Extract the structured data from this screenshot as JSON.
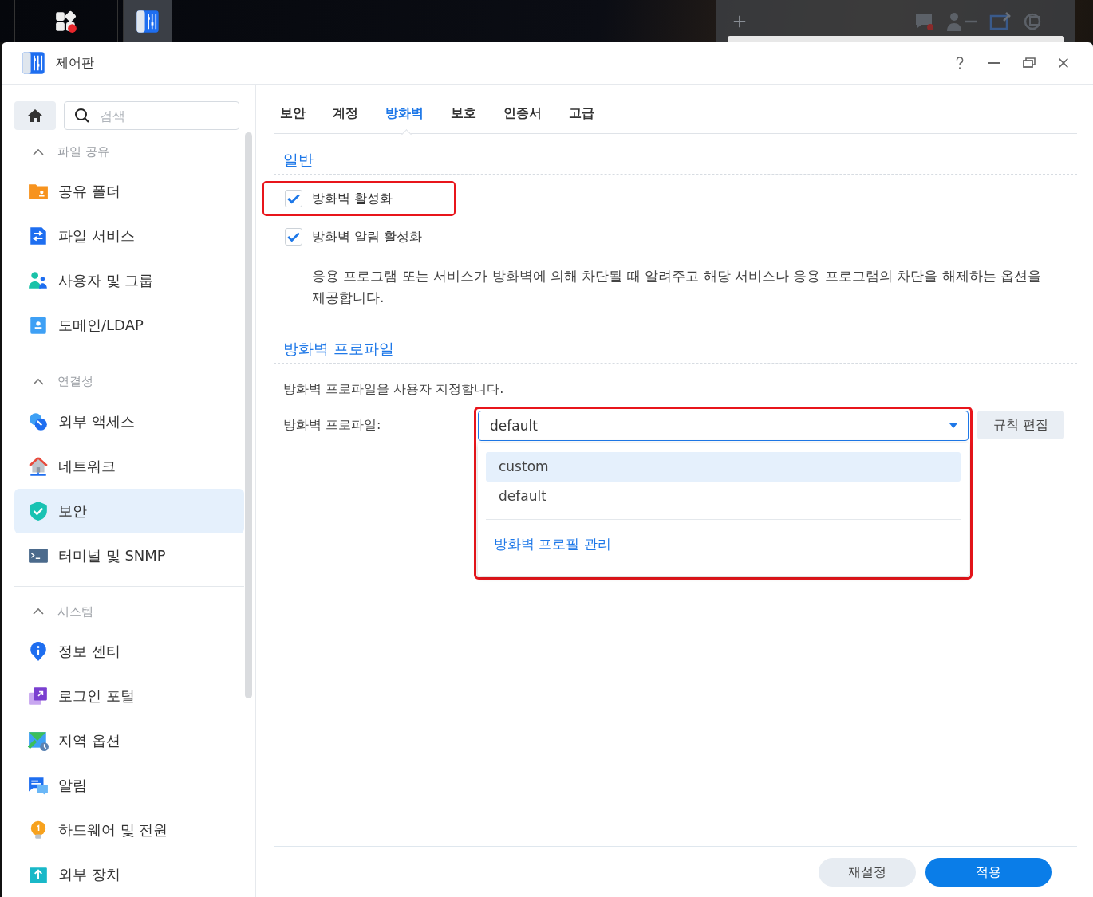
{
  "taskbar": {
    "apps": [
      {
        "kind": "main-menu",
        "selected": false
      },
      {
        "kind": "control-panel",
        "selected": true
      }
    ]
  },
  "window": {
    "title": "제어판"
  },
  "sidebar": {
    "search": {
      "placeholder": "검색"
    },
    "sections": [
      {
        "title": "파일 공유",
        "expanded": true,
        "items": [
          {
            "label": "공유 폴더",
            "kind": "folder",
            "selected": false
          },
          {
            "label": "파일 서비스",
            "kind": "file-service",
            "selected": false
          },
          {
            "label": "사용자 및 그룹",
            "kind": "users",
            "selected": false
          },
          {
            "label": "도메인/LDAP",
            "kind": "domain",
            "selected": false
          }
        ]
      },
      {
        "title": "연결성",
        "expanded": true,
        "items": [
          {
            "label": "외부 액세스",
            "kind": "external-access",
            "selected": false
          },
          {
            "label": "네트워크",
            "kind": "network",
            "selected": false
          },
          {
            "label": "보안",
            "kind": "security",
            "selected": true
          },
          {
            "label": "터미널 및 SNMP",
            "kind": "terminal",
            "selected": false
          }
        ]
      },
      {
        "title": "시스템",
        "expanded": true,
        "items": [
          {
            "label": "정보 센터",
            "kind": "info",
            "selected": false
          },
          {
            "label": "로그인 포털",
            "kind": "login-portal",
            "selected": false
          },
          {
            "label": "지역 옵션",
            "kind": "region",
            "selected": false
          },
          {
            "label": "알림",
            "kind": "notification",
            "selected": false
          },
          {
            "label": "하드웨어 및 전원",
            "kind": "hardware",
            "selected": false
          },
          {
            "label": "외부 장치",
            "kind": "external-device",
            "selected": false
          }
        ]
      }
    ]
  },
  "tabs": [
    {
      "label": "보안",
      "selected": false
    },
    {
      "label": "계정",
      "selected": false
    },
    {
      "label": "방화벽",
      "selected": true
    },
    {
      "label": "보호",
      "selected": false
    },
    {
      "label": "인증서",
      "selected": false
    },
    {
      "label": "고급",
      "selected": false
    }
  ],
  "general": {
    "title": "일반",
    "options": [
      {
        "label": "방화벽 활성화",
        "checked": true,
        "highlighted": true
      },
      {
        "label": "방화벽 알림 활성화",
        "checked": true,
        "highlighted": false
      }
    ],
    "description": "응용 프로그램 또는 서비스가 방화벽에 의해 차단될 때 알려주고 해당 서비스나 응용 프로그램의 차단을 해제하는 옵션을 제공합니다."
  },
  "profile": {
    "title": "방화벽 프로파일",
    "description": "방화벽 프로파일을 사용자 지정합니다.",
    "field_label": "방화벽 프로파일:",
    "select": {
      "value": "default",
      "expanded": true,
      "highlighted": true,
      "options": [
        {
          "label": "custom",
          "hovered": true
        },
        {
          "label": "default",
          "hovered": false
        }
      ],
      "manage_link": "방화벽 프로필 관리"
    },
    "edit_button": "규칙 편집"
  },
  "footer": {
    "buttons": [
      {
        "label": "재설정",
        "kind": "secondary"
      },
      {
        "label": "적용",
        "kind": "primary"
      }
    ]
  }
}
